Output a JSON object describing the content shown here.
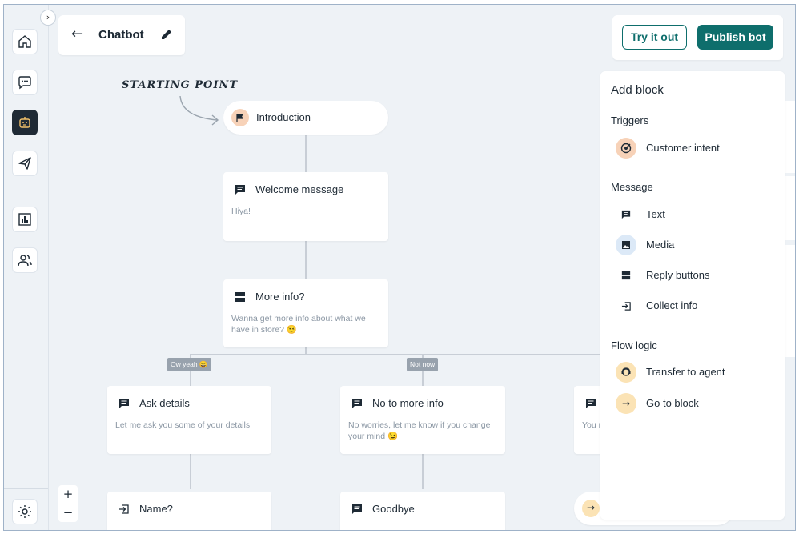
{
  "sidebar": {
    "collapse_icon": "chevron-right-icon",
    "items": [
      {
        "name": "home",
        "icon": "home-icon",
        "active": false
      },
      {
        "name": "inbox",
        "icon": "chat-icon",
        "active": false
      },
      {
        "name": "chatbot",
        "icon": "bot-icon",
        "active": true
      },
      {
        "name": "campaigns",
        "icon": "send-icon",
        "active": false
      },
      {
        "name": "reports",
        "icon": "bar-chart-icon",
        "active": false
      },
      {
        "name": "contacts",
        "icon": "users-icon",
        "active": false
      }
    ],
    "settings_icon": "gear-icon"
  },
  "header": {
    "title": "Chatbot",
    "back_icon": "arrow-left-icon",
    "edit_icon": "pencil-icon"
  },
  "actions": {
    "try_label": "Try it out",
    "publish_label": "Publish bot"
  },
  "canvas": {
    "start_label": "STARTING POINT",
    "nodes": {
      "intro": {
        "title": "Introduction",
        "icon": "flag-icon"
      },
      "welcome": {
        "title": "Welcome message",
        "body": "Hiya!",
        "icon": "message-icon"
      },
      "more_info": {
        "title": "More info?",
        "body": "Wanna get more info about what we have in store? 😉",
        "icon": "buttons-icon"
      },
      "ask_details": {
        "title": "Ask details",
        "body": "Let me ask you some of your details",
        "icon": "message-icon"
      },
      "no_more_info": {
        "title": "No to more info",
        "body": "No worries, let me know if you change your mind 😉",
        "icon": "message-icon"
      },
      "name": {
        "title": "Name?",
        "icon": "collect-icon"
      },
      "goodbye": {
        "title": "Goodbye",
        "icon": "message-icon"
      },
      "partial_right": {
        "body": "You r"
      }
    },
    "branches": {
      "yes": "Ow yeah 😄",
      "no": "Not now"
    },
    "zoom": {
      "in": "+",
      "out": "−"
    }
  },
  "add_block": {
    "title": "Add block",
    "sections": [
      {
        "label": "Triggers",
        "items": [
          {
            "label": "Customer intent",
            "icon": "target-icon",
            "color": "#f7d2b8"
          }
        ]
      },
      {
        "label": "Message",
        "items": [
          {
            "label": "Text",
            "icon": "message-icon",
            "color": "#ffffff"
          },
          {
            "label": "Media",
            "icon": "image-icon",
            "color": "#dce9f7"
          },
          {
            "label": "Reply buttons",
            "icon": "buttons-icon",
            "color": "#ffffff"
          },
          {
            "label": "Collect info",
            "icon": "collect-icon",
            "color": "#ffffff"
          }
        ]
      },
      {
        "label": "Flow logic",
        "items": [
          {
            "label": "Transfer to agent",
            "icon": "agent-icon",
            "color": "#fbe3b5"
          },
          {
            "label": "Go to block",
            "icon": "arrow-right-icon",
            "color": "#fbe3b5"
          }
        ]
      }
    ]
  },
  "colors": {
    "brand": "#0e6e6c",
    "sidebar_active": "#1f2a35",
    "canvas_bg": "#eef2f6",
    "branch_tag": "#98a2ad"
  }
}
